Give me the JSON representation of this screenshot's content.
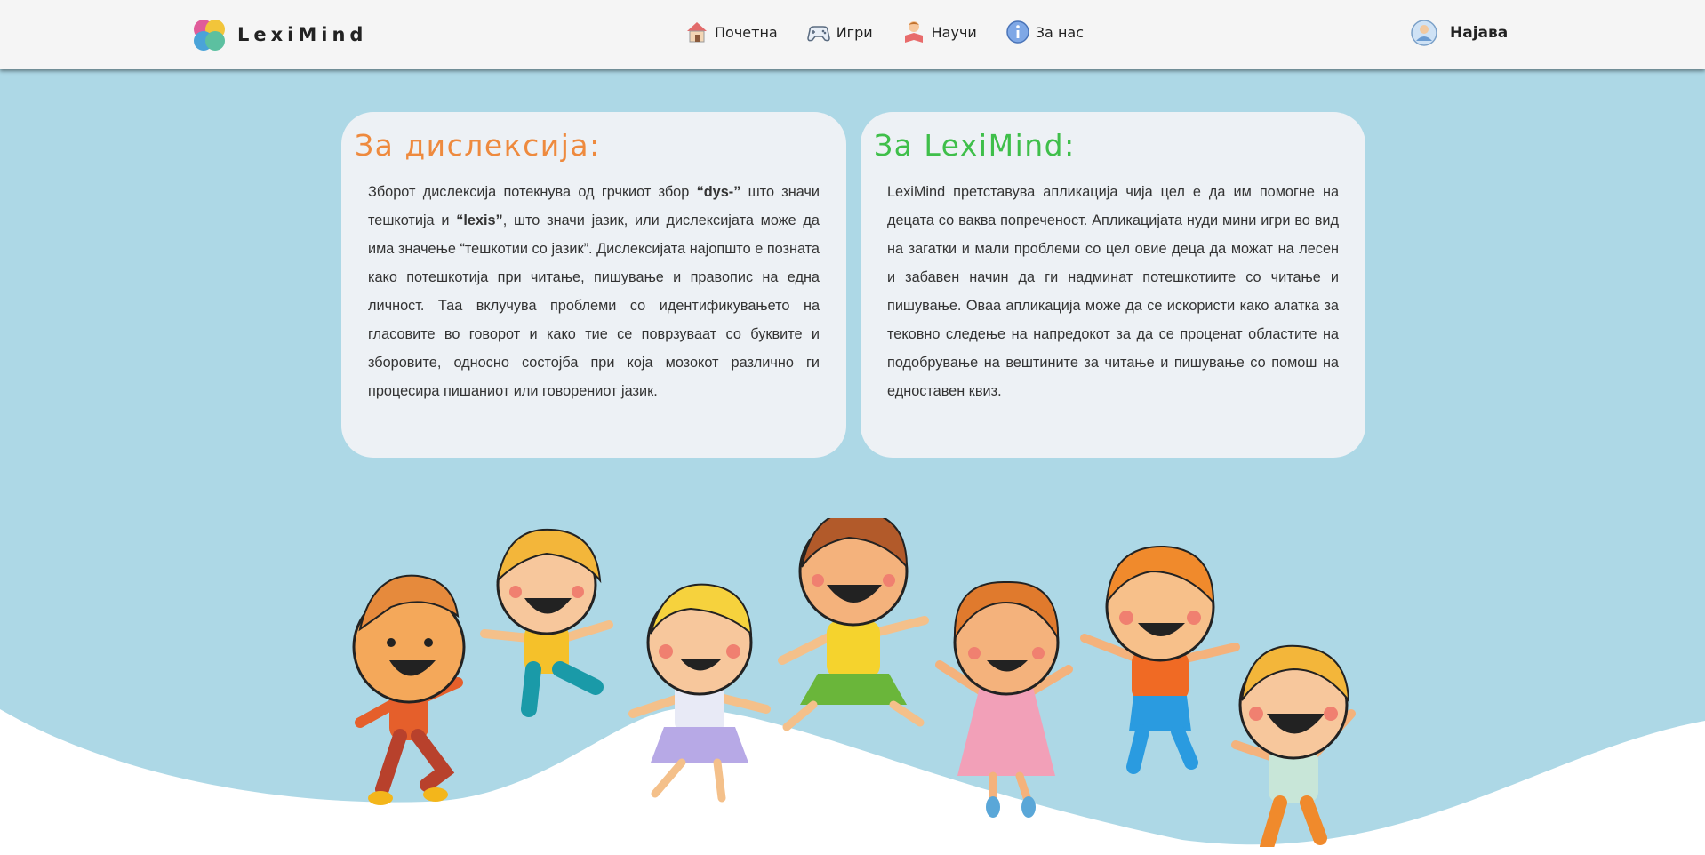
{
  "navbar": {
    "brand": "LexiMind",
    "items": [
      {
        "label": "Почетна",
        "icon": "home-icon"
      },
      {
        "label": "Игри",
        "icon": "gamepad-icon"
      },
      {
        "label": "Научи",
        "icon": "reading-child-icon"
      },
      {
        "label": "За нас",
        "icon": "info-icon"
      }
    ],
    "login": {
      "label": "Најава",
      "icon": "user-avatar-icon"
    }
  },
  "cards": {
    "dyslexia": {
      "title": "За дислексија:",
      "p1": "Зборот дислексија потекнува од грчкиот збор ",
      "term1": "“dys-”",
      "p2": " што значи тешкотија и ",
      "term2": "“lexis”",
      "p3": ", што значи јазик, или дислексијата може да има значење “тешкотии со јазик”. Дислексијата најопшто е позната како потешкотија при читање, пишување и правопис на една личност. Таа вклучува проблеми со идентификувањето на гласовите во говорот и како тие се поврзуваат со буквите и зборовите, односно состојба при која мозокот различно ги процесира пишаниот или говорениот јазик."
    },
    "about": {
      "title": "За LexiMind:",
      "text": "LexiMind претставува апликација чија цел е да им помогне на децата со ваква попреченост. Апликацијата нуди мини игри во вид на загатки и мали проблеми со цел овие деца да можат на лесен и забавен начин да ги надминат потешкотиите со читање и пишување. Оваа апликација може да се искористи како алатка за тековно следење на напредокот за да се проценат областите на подобрување на вештините за читање и пишување со помош на едноставен квиз."
    }
  },
  "illustration": {
    "icon": "happy-kids-illustration"
  },
  "colors": {
    "navbar_bg": "#f5f5f5",
    "hero_bg": "#add8e6",
    "card_bg": "#edf1f5",
    "dyslexia_title": "#ee8a3e",
    "about_title": "#3fbf4a"
  }
}
